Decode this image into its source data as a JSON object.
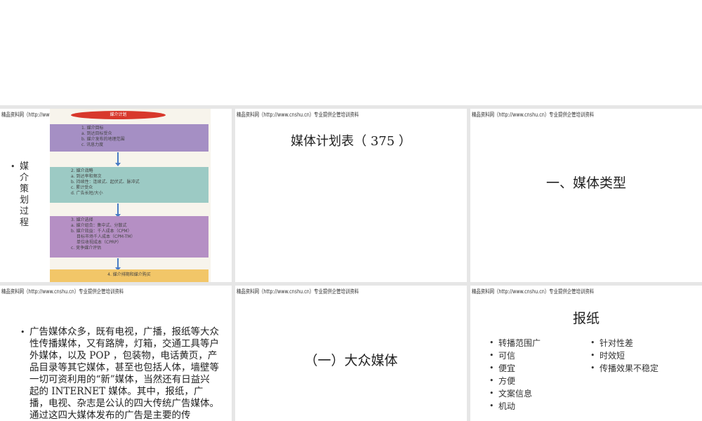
{
  "header": "精品资料网（http://www.cnshu.cn）专业提供企管培训资料",
  "slide1": {
    "bullet": "媒介策划过程",
    "flow": {
      "title": "媒介计划",
      "box1": [
        "1. 媒介目标",
        "a. 到达目标受众",
        "b. 媒介发布的地理范围",
        "c. 讯息力度"
      ],
      "box2": [
        "2. 媒介战略",
        "a. 到达率和频次",
        "b. 持续性：连续式、起伏式、脉冲式",
        "c. 累计受众",
        "d. 广告长短/大小"
      ],
      "box3": [
        "3. 媒介选择",
        "a. 媒介组合：集中式、分散式",
        "b. 媒介效益：千人成本（CPM）",
        "目标市场千人成本（CPM-TM）",
        "单位收视成本（CPRP）",
        "c. 竞争媒介评估"
      ],
      "box4": "4. 媒介排期和媒介购买"
    }
  },
  "slide2": {
    "title": "媒体计划表（ 375 ）"
  },
  "slide3": {
    "title": "一、媒体类型"
  },
  "slide4": {
    "paragraph": "广告媒体众多，既有电视，广播，报纸等大众性传播媒体，又有路牌，灯箱，交通工具等户外媒体，以及 POP ，包装物，电话黄页，产品目录等其它媒体，甚至也包括人体，墙壁等一切可资利用的“新”媒体，当然还有日益兴起的 INTERNET 媒体。其中，报纸，广播，电视、杂志是公认的四大传统广告媒体。通过这四大媒体发布的广告是主要的传"
  },
  "slide5": {
    "title": "（一）大众媒体"
  },
  "slide6": {
    "title": "报纸",
    "pros": [
      "转播范围广",
      "可信",
      "便宜",
      "方便",
      "文案信息",
      "机动"
    ],
    "cons": [
      "针对性差",
      "时效短",
      "传播效果不稳定"
    ]
  }
}
